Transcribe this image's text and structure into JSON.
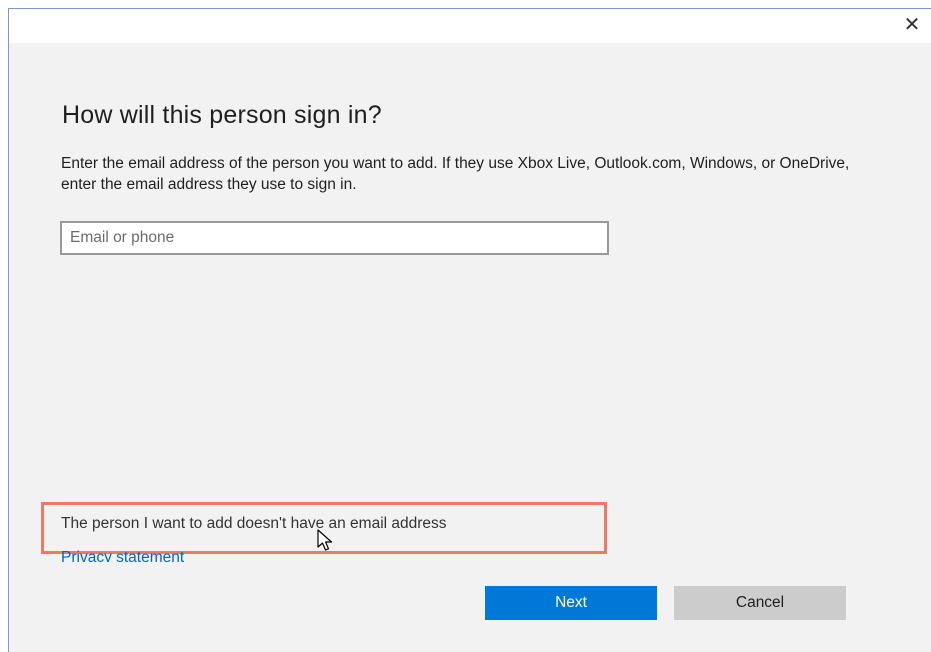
{
  "dialog": {
    "close_glyph": "✕",
    "heading": "How will this person sign in?",
    "description": "Enter the email address of the person you want to add. If they use Xbox Live, Outlook.com, Windows, or OneDrive, enter the email address they use to sign in.",
    "email_input": {
      "placeholder": "Email or phone",
      "value": ""
    },
    "no_email_link": "The person I want to add doesn't have an email address",
    "privacy_link": "Privacy statement",
    "buttons": {
      "next": "Next",
      "cancel": "Cancel"
    }
  },
  "colors": {
    "dialog_bg": "#f2f2f2",
    "accent": "#0078d7",
    "link": "#0066cc",
    "highlight": "#ef7a63",
    "cancel_bg": "#cccccc"
  },
  "icons": {
    "close": "close-icon",
    "cursor": "mouse-pointer-icon"
  }
}
